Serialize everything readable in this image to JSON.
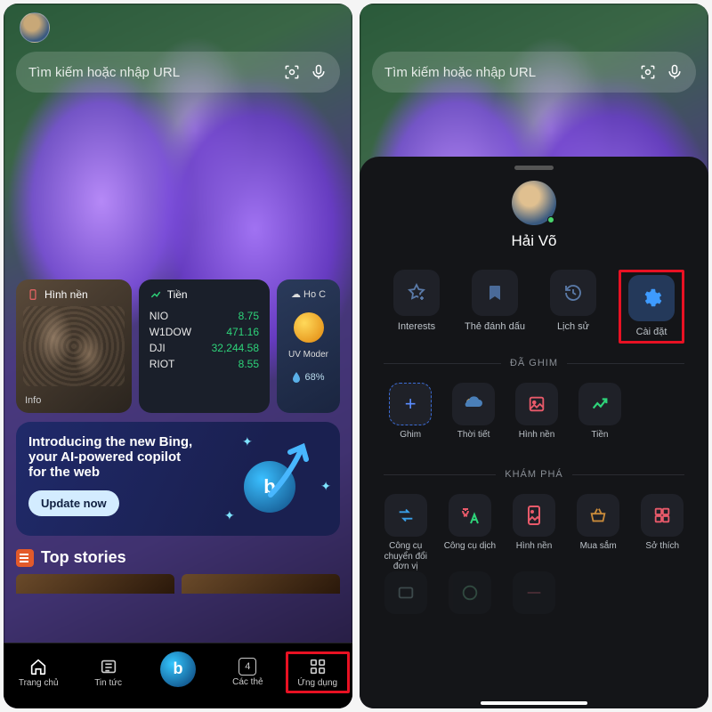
{
  "left": {
    "search": {
      "placeholder": "Tìm kiếm hoặc nhập URL"
    },
    "cards": {
      "wallpaper": {
        "title": "Hình nền",
        "info": "Info"
      },
      "stocks": {
        "title": "Tiền",
        "rows": [
          {
            "sym": "NIO",
            "val": "8.75"
          },
          {
            "sym": "W1DOW",
            "val": "471.16"
          },
          {
            "sym": "DJI",
            "val": "32,244.58"
          },
          {
            "sym": "RIOT",
            "val": "8.55"
          }
        ]
      },
      "weather": {
        "title": "Ho C",
        "uv": "UV Moder",
        "humid": "68%"
      }
    },
    "promo": {
      "line1": "Introducing the new Bing,",
      "line2": "your AI-powered copilot",
      "line3": "for the web",
      "cta": "Update now"
    },
    "top_stories": "Top stories",
    "nav": [
      {
        "label": "Trang chủ"
      },
      {
        "label": "Tin tức"
      },
      {
        "label": ""
      },
      {
        "label": "Các thẻ",
        "badge": "4"
      },
      {
        "label": "Ứng dụng"
      }
    ]
  },
  "right": {
    "search": {
      "placeholder": "Tìm kiếm hoặc nhập URL"
    },
    "panel": {
      "username": "Hải Võ",
      "quick": [
        {
          "label": "Interests"
        },
        {
          "label": "Thẻ đánh dấu"
        },
        {
          "label": "Lịch sử"
        },
        {
          "label": "Cài đặt"
        }
      ],
      "sections": {
        "pinned": {
          "title": "ĐÃ GHIM",
          "items": [
            {
              "label": "Ghim"
            },
            {
              "label": "Thời tiết"
            },
            {
              "label": "Hình nền"
            },
            {
              "label": "Tiền"
            }
          ]
        },
        "explore": {
          "title": "KHÁM PHÁ",
          "items": [
            {
              "label": "Công cụ chuyển đổi đơn vị"
            },
            {
              "label": "Công cụ dịch"
            },
            {
              "label": "Hình nền"
            },
            {
              "label": "Mua sắm"
            },
            {
              "label": "Sở thích"
            }
          ]
        }
      }
    }
  }
}
